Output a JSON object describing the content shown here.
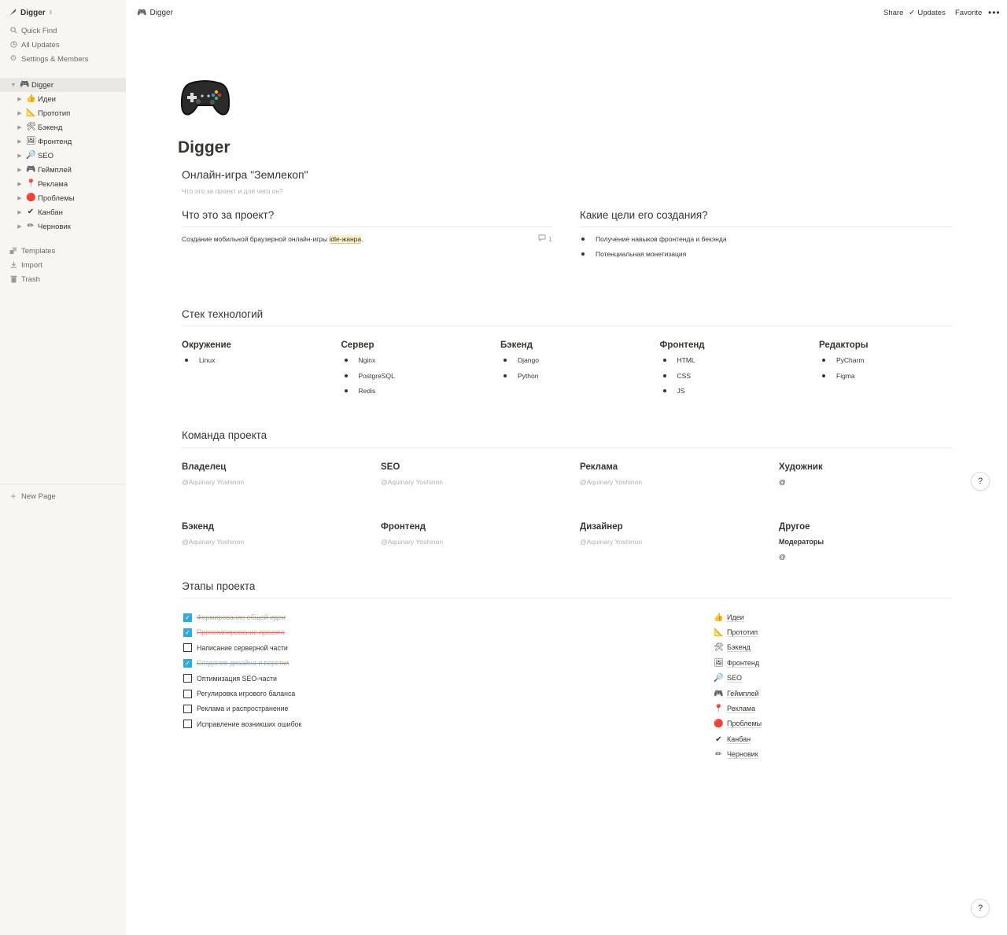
{
  "workspace": {
    "name": "Digger",
    "icon": "feather-icon"
  },
  "sidebar": {
    "nav": [
      {
        "label": "Quick Find",
        "icon": "search-icon"
      },
      {
        "label": "All Updates",
        "icon": "clock-icon"
      },
      {
        "label": "Settings & Members",
        "icon": "gear-icon"
      }
    ],
    "root": {
      "label": "Digger",
      "emoji": "🎮"
    },
    "pages": [
      {
        "label": "Идеи",
        "emoji": "👍"
      },
      {
        "label": "Прототип",
        "emoji": "📐"
      },
      {
        "label": "Бэкенд",
        "emoji": "🛠"
      },
      {
        "label": "Фронтенд",
        "emoji": "🖼"
      },
      {
        "label": "SEO",
        "emoji": "🔎"
      },
      {
        "label": "Геймплей",
        "emoji": "🎮"
      },
      {
        "label": "Реклама",
        "emoji": "📍"
      },
      {
        "label": "Проблемы",
        "emoji": "🔴"
      },
      {
        "label": "Канбан",
        "emoji": "✔"
      },
      {
        "label": "Черновик",
        "emoji": "✏"
      }
    ],
    "bottom": [
      {
        "label": "Templates",
        "icon": "templates-icon"
      },
      {
        "label": "Import",
        "icon": "import-icon"
      },
      {
        "label": "Trash",
        "icon": "trash-icon"
      }
    ],
    "new_page": "New Page"
  },
  "topbar": {
    "breadcrumb": "Digger",
    "share": "Share",
    "updates": "Updates",
    "favorite": "Favorite",
    "more": "•••"
  },
  "page": {
    "title": "Digger",
    "heading": "Онлайн-игра \"Землекоп\"",
    "subtitle": "Что это за проект и для чего он?",
    "what": {
      "title": "Что это за проект?",
      "text_before": "Создание мобильной браузерной онлайн-игры ",
      "text_highlight": "idle-жанра",
      "text_after": ".",
      "comments": "1"
    },
    "goals": {
      "title": "Какие цели его создания?",
      "items": [
        "Получение навыков фронтенда и бекэнда",
        "Потенциальная монетизация"
      ]
    },
    "stack": {
      "title": "Стек технологий",
      "columns": [
        {
          "title": "Окружение",
          "items": [
            "Linux"
          ]
        },
        {
          "title": "Сервер",
          "items": [
            "Nginx",
            "PostgreSQL",
            "Redis"
          ]
        },
        {
          "title": "Бэкенд",
          "items": [
            "Django",
            "Python"
          ]
        },
        {
          "title": "Фронтенд",
          "items": [
            "HTML",
            "CSS",
            "JS"
          ]
        },
        {
          "title": "Редакторы",
          "items": [
            "PyCharm",
            "Figma"
          ]
        }
      ]
    },
    "team": {
      "title": "Команда проекта",
      "roles": [
        {
          "title": "Владелец",
          "value": "@Aquinary Yoshinon"
        },
        {
          "title": "SEO",
          "value": "@Aquinary Yoshinon"
        },
        {
          "title": "Реклама",
          "value": "@Aquinary Yoshinon"
        },
        {
          "title": "Художник",
          "value": "@"
        },
        {
          "title": "Бэкенд",
          "value": "@Aquinary Yoshinon"
        },
        {
          "title": "Фронтенд",
          "value": "@Aquinary Yoshinon"
        },
        {
          "title": "Дизайнер",
          "value": "@Aquinary Yoshinon"
        },
        {
          "title": "Другое",
          "sublabel": "Модераторы",
          "value": "@"
        }
      ]
    },
    "stages": {
      "title": "Этапы проекта",
      "todos": [
        {
          "label": "Формирование общей идеи",
          "checked": true
        },
        {
          "label": "Прототипирование проекта",
          "checked": true
        },
        {
          "label": "Написание серверной части",
          "checked": false
        },
        {
          "label": "Создание дизайна и верстки",
          "checked": true
        },
        {
          "label": "Оптимизация SEO-части",
          "checked": false
        },
        {
          "label": "Регулировка игрового баланса",
          "checked": false
        },
        {
          "label": "Реклама и распространение",
          "checked": false
        },
        {
          "label": "Исправление возникших ошибок",
          "checked": false
        }
      ],
      "links": [
        {
          "label": "Идеи",
          "emoji": "👍"
        },
        {
          "label": "Прототип",
          "emoji": "📐"
        },
        {
          "label": "Бэкенд",
          "emoji": "🛠"
        },
        {
          "label": "Фронтенд",
          "emoji": "🖼"
        },
        {
          "label": "SEO",
          "emoji": "🔎"
        },
        {
          "label": "Геймплей",
          "emoji": "🎮"
        },
        {
          "label": "Реклама",
          "emoji": "📍"
        },
        {
          "label": "Проблемы",
          "emoji": "🔴"
        },
        {
          "label": "Канбан",
          "emoji": "✔"
        },
        {
          "label": "Черновик",
          "emoji": "✏"
        }
      ]
    },
    "help": "?"
  }
}
